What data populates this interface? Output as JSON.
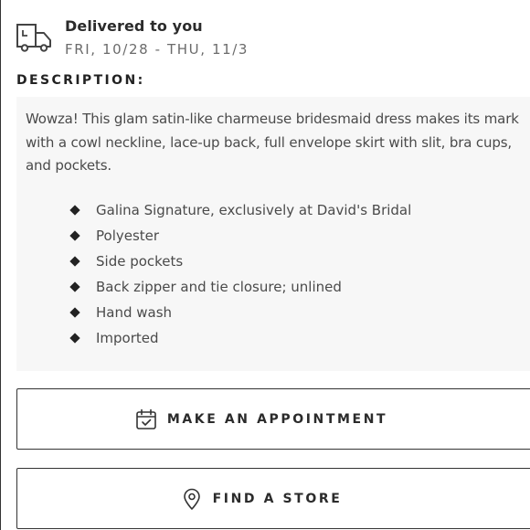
{
  "delivery": {
    "icon": "delivery-truck-icon",
    "title": "Delivered to you",
    "dates": "FRI, 10/28 - THU, 11/3"
  },
  "description": {
    "heading": "DESCRIPTION:",
    "paragraph": "Wowza! This glam satin-like charmeuse bridesmaid dress makes its mark with a cowl neckline, lace-up back, full envelope skirt with slit, bra cups, and pockets.",
    "bullets": [
      "Galina Signature, exclusively at David's Bridal",
      "Polyester",
      "Side pockets",
      "Back zipper and tie closure; unlined",
      "Hand wash",
      "Imported"
    ]
  },
  "buttons": {
    "appointment": {
      "label": "MAKE AN APPOINTMENT",
      "icon": "calendar-check-icon"
    },
    "store": {
      "label": "FIND A STORE",
      "icon": "location-pin-icon"
    }
  },
  "colors": {
    "text_dark": "#2b2b2b",
    "text_body": "#4a4a4a",
    "text_muted": "#6b6b6b",
    "panel_bg": "#f7f7f7",
    "border": "#333333"
  }
}
